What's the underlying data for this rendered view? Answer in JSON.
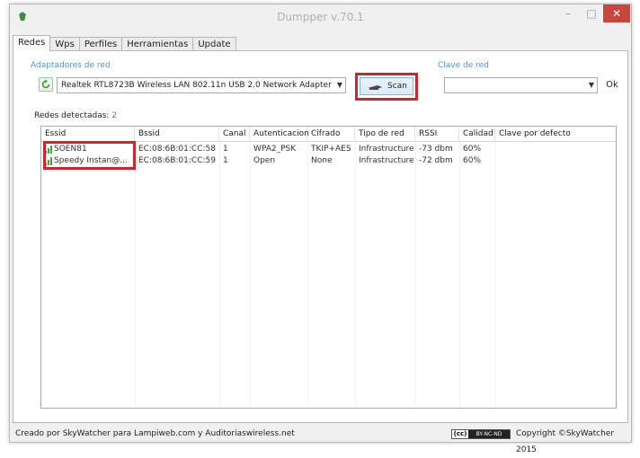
{
  "window": {
    "title": "Dumpper v.70.1",
    "minimize": "–",
    "maximize": "□",
    "close": "✕"
  },
  "tabs": [
    "Redes",
    "Wps",
    "Perfiles",
    "Herramientas",
    "Update"
  ],
  "adapters": {
    "label": "Adaptadores de red",
    "selected": "Realtek RTL8723B Wireless LAN 802.11n USB 2.0 Network Adapter",
    "scan_label": "Scan"
  },
  "key": {
    "label": "Clave de red",
    "value": "",
    "ok_label": "Ok"
  },
  "detected": {
    "label": "Redes detectadas:",
    "count": "2"
  },
  "table": {
    "columns": [
      "Essid",
      "Bssid",
      "Canal",
      "Autenticacion",
      "Cifrado",
      "Tipo de red",
      "RSSI",
      "Calidad",
      "Clave por defecto"
    ],
    "rows": [
      [
        "SOEN81",
        "EC:08:6B:01:CC:58",
        "1",
        "WPA2_PSK",
        "TKIP+AES",
        "Infrastructure",
        "-73 dbm",
        "60%",
        ""
      ],
      [
        "Speedy Instan@...",
        "EC:08:6B:01:CC:59",
        "1",
        "Open",
        "None",
        "Infrastructure",
        "-72 dbm",
        "60%",
        ""
      ]
    ]
  },
  "status": {
    "left": "Creado por SkyWatcher para Lampiweb.com y Auditoriaswireless.net",
    "cc": "(cc)",
    "cc_terms": "BY-NC-ND",
    "right": "Copyright ©SkyWatcher 2015"
  },
  "colors": {
    "accent_blue": "#5b8fc8",
    "highlight_red": "#d0232a",
    "signal_green": "#3ea93a",
    "close_red": "#c9463d"
  },
  "icons": {
    "app": "dumpper-app-icon",
    "refresh": "refresh-icon",
    "scan": "scan-antenna-icon",
    "signal": "signal-bars-icon"
  }
}
